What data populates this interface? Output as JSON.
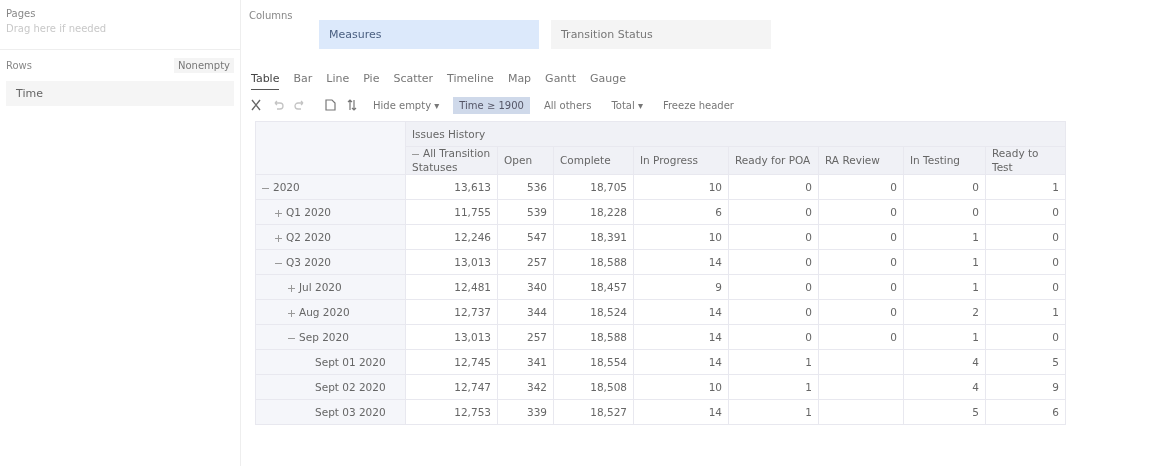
{
  "pages": {
    "label": "Pages",
    "placeholder": "Drag here if needed"
  },
  "rows_panel": {
    "label": "Rows",
    "nonempty_button": "Nonempty",
    "items": [
      "Time"
    ]
  },
  "columns_panel": {
    "label": "Columns",
    "items": [
      {
        "label": "Measures",
        "selected": true
      },
      {
        "label": "Transition Status",
        "selected": false
      }
    ]
  },
  "tabs": [
    {
      "label": "Table",
      "selected": true
    },
    {
      "label": "Bar",
      "selected": false
    },
    {
      "label": "Line",
      "selected": false
    },
    {
      "label": "Pie",
      "selected": false
    },
    {
      "label": "Scatter",
      "selected": false
    },
    {
      "label": "Timeline",
      "selected": false
    },
    {
      "label": "Map",
      "selected": false
    },
    {
      "label": "Gantt",
      "selected": false
    },
    {
      "label": "Gauge",
      "selected": false
    }
  ],
  "toolbar": [
    {
      "kind": "cut"
    },
    {
      "kind": "undo"
    },
    {
      "kind": "redo"
    },
    {
      "kind": "page"
    },
    {
      "kind": "swap"
    },
    {
      "kind": "text",
      "label": "Hide empty ▾",
      "active": false
    },
    {
      "kind": "text",
      "label": "Time ≥ 1900",
      "active": true
    },
    {
      "kind": "text",
      "label": "All others",
      "active": false
    },
    {
      "kind": "text",
      "label": "Total ▾",
      "active": false
    },
    {
      "kind": "text",
      "label": "Freeze header",
      "active": false
    }
  ],
  "table": {
    "group_header": "Issues History",
    "columns": [
      {
        "label": "All Transition Statuses",
        "expanded": true
      },
      {
        "label": "Open"
      },
      {
        "label": "Complete"
      },
      {
        "label": "In Progress"
      },
      {
        "label": "Ready for POA"
      },
      {
        "label": "RA Review"
      },
      {
        "label": "In Testing"
      },
      {
        "label": "Ready to Test"
      }
    ],
    "rows": [
      {
        "label": "2020",
        "expanded": true,
        "values": {
          "all": "13,613",
          "open": "536",
          "complete": "18,705",
          "in_progress": "10",
          "ready_for_poa": "0",
          "ra_review": "0",
          "in_testing": "0",
          "ready_to_test": "1"
        },
        "children": [
          {
            "label": "Q1 2020",
            "expanded": false,
            "values": {
              "all": "11,755",
              "open": "539",
              "complete": "18,228",
              "in_progress": "6",
              "ready_for_poa": "0",
              "ra_review": "0",
              "in_testing": "0",
              "ready_to_test": "0"
            }
          },
          {
            "label": "Q2 2020",
            "expanded": false,
            "values": {
              "all": "12,246",
              "open": "547",
              "complete": "18,391",
              "in_progress": "10",
              "ready_for_poa": "0",
              "ra_review": "0",
              "in_testing": "1",
              "ready_to_test": "0"
            }
          },
          {
            "label": "Q3 2020",
            "expanded": true,
            "values": {
              "all": "13,013",
              "open": "257",
              "complete": "18,588",
              "in_progress": "14",
              "ready_for_poa": "0",
              "ra_review": "0",
              "in_testing": "1",
              "ready_to_test": "0"
            },
            "children": [
              {
                "label": "Jul 2020",
                "expanded": false,
                "values": {
                  "all": "12,481",
                  "open": "340",
                  "complete": "18,457",
                  "in_progress": "9",
                  "ready_for_poa": "0",
                  "ra_review": "0",
                  "in_testing": "1",
                  "ready_to_test": "0"
                }
              },
              {
                "label": "Aug 2020",
                "expanded": false,
                "values": {
                  "all": "12,737",
                  "open": "344",
                  "complete": "18,524",
                  "in_progress": "14",
                  "ready_for_poa": "0",
                  "ra_review": "0",
                  "in_testing": "2",
                  "ready_to_test": "1"
                }
              },
              {
                "label": "Sep 2020",
                "expanded": true,
                "values": {
                  "all": "13,013",
                  "open": "257",
                  "complete": "18,588",
                  "in_progress": "14",
                  "ready_for_poa": "0",
                  "ra_review": "0",
                  "in_testing": "1",
                  "ready_to_test": "0"
                },
                "children": [
                  {
                    "label": "Sept 01 2020",
                    "values": {
                      "all": "12,745",
                      "open": "341",
                      "complete": "18,554",
                      "in_progress": "14",
                      "ready_for_poa": "1",
                      "in_testing": "4",
                      "ready_to_test": "5"
                    }
                  },
                  {
                    "label": "Sept 02 2020",
                    "values": {
                      "all": "12,747",
                      "open": "342",
                      "complete": "18,508",
                      "in_progress": "10",
                      "ready_for_poa": "1",
                      "in_testing": "4",
                      "ready_to_test": "9"
                    }
                  },
                  {
                    "label": "Sept 03 2020",
                    "values": {
                      "all": "12,753",
                      "open": "339",
                      "complete": "18,527",
                      "in_progress": "14",
                      "ready_for_poa": "1",
                      "in_testing": "5",
                      "ready_to_test": "6"
                    }
                  }
                ]
              }
            ]
          }
        ]
      }
    ]
  }
}
